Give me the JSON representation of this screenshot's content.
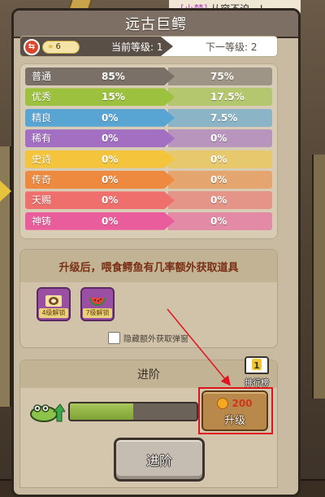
{
  "chat": {
    "speaker": "[小梦]",
    "message": "从容不迫，!"
  },
  "window": {
    "title": "远古巨鳄"
  },
  "level": {
    "badge_value": "6",
    "current_label": "当前等级: 1",
    "next_label": "下一等级: 2"
  },
  "rarity": [
    {
      "name": "普通",
      "current": "85%",
      "next": "75%",
      "color": "#7a7068"
    },
    {
      "name": "优秀",
      "current": "15%",
      "next": "17.5%",
      "color": "#9cc13f"
    },
    {
      "name": "精良",
      "current": "0%",
      "next": "7.5%",
      "color": "#58a5d4"
    },
    {
      "name": "稀有",
      "current": "0%",
      "next": "0%",
      "color": "#a26fc2"
    },
    {
      "name": "史诗",
      "current": "0%",
      "next": "0%",
      "color": "#f3c43c"
    },
    {
      "name": "传奇",
      "current": "0%",
      "next": "0%",
      "color": "#ee8a3f"
    },
    {
      "name": "天赐",
      "current": "0%",
      "next": "0%",
      "color": "#ee6f6b"
    },
    {
      "name": "神铸",
      "current": "0%",
      "next": "0%",
      "color": "#ea5d9c"
    }
  ],
  "bonus": {
    "heading": "升级后，喂食鳄鱼有几率额外获取道具",
    "items": [
      {
        "label": "4级解锁",
        "icon": "coconut-icon"
      },
      {
        "label": "7级解锁",
        "icon": "watermelon-icon"
      }
    ],
    "hide_label": "隐藏额外获取弹窗"
  },
  "advance": {
    "heading": "进阶",
    "rank_number": "1",
    "rank_label": "排行榜",
    "progress": 0.5,
    "upgrade_cost": "200",
    "upgrade_label": "升级",
    "advance_button": "进阶"
  },
  "colors": {
    "highlight": "#e0141f",
    "progress_fill": "#8fb146",
    "title_bar": "#7d6f63"
  }
}
